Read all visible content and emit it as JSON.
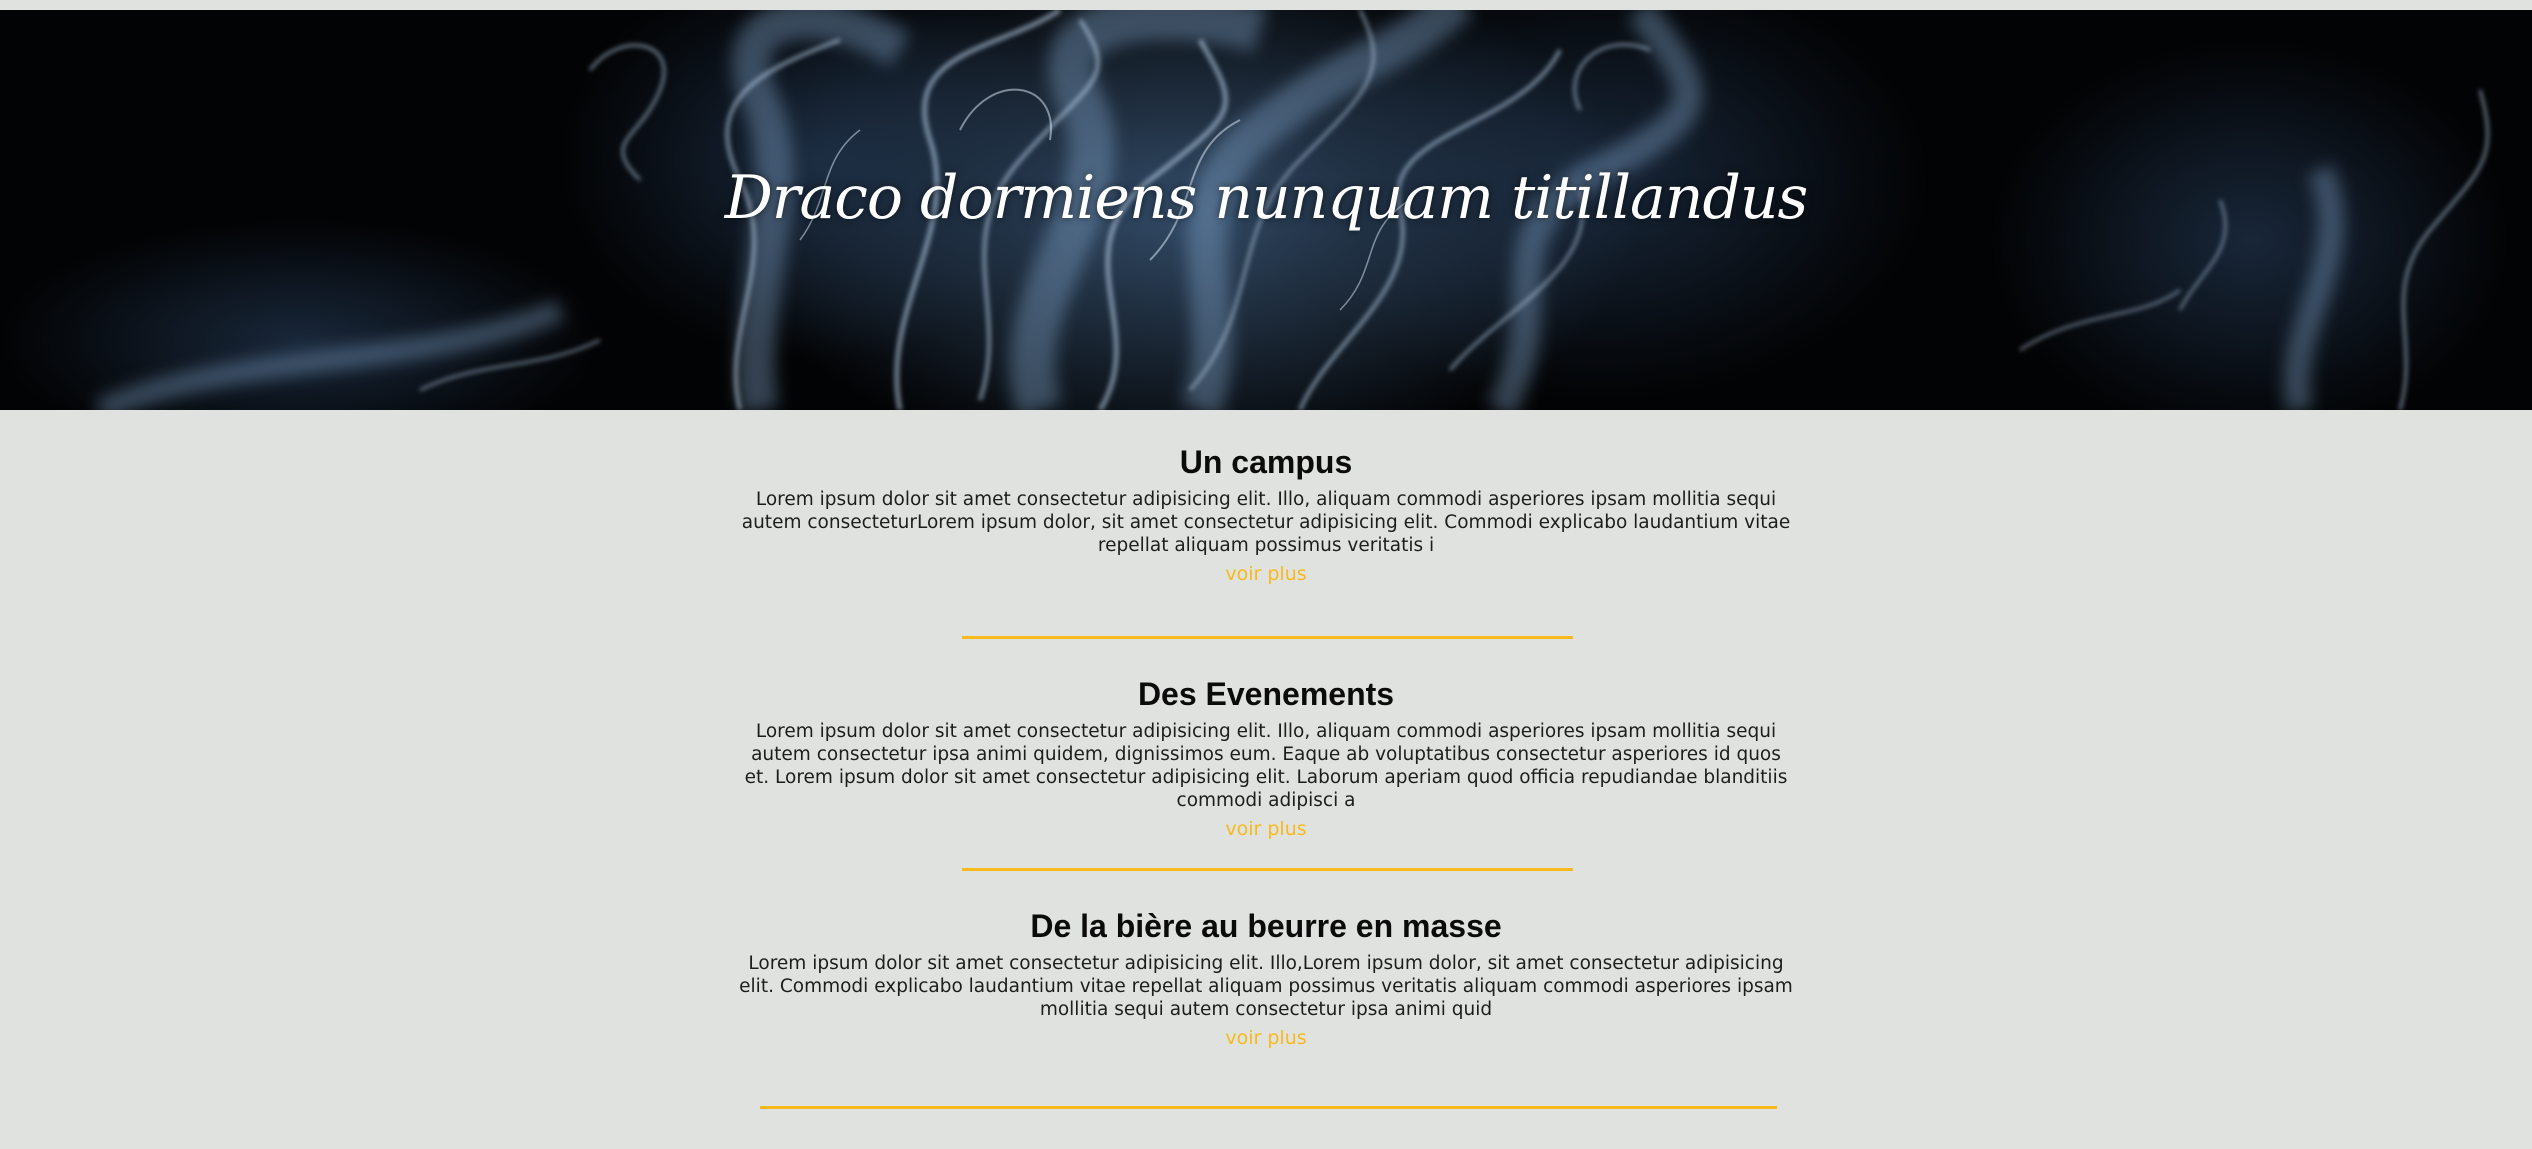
{
  "hero": {
    "title": "Draco dormiens nunquam titillandus"
  },
  "sections": [
    {
      "heading": "Un campus",
      "text": "Lorem ipsum dolor sit amet consectetur adipisicing elit. Illo, aliquam commodi asperiores ipsam mollitia sequi autem consecteturLorem ipsum dolor, sit amet consectetur adipisicing elit. Commodi explicabo laudantium vitae repellat aliquam possimus veritatis i",
      "link": "voir plus"
    },
    {
      "heading": "Des Evenements",
      "text": "Lorem ipsum dolor sit amet consectetur adipisicing elit. Illo, aliquam commodi asperiores ipsam mollitia sequi autem consectetur ipsa animi quidem, dignissimos eum. Eaque ab voluptatibus consectetur asperiores id quos et. Lorem ipsum dolor sit amet consectetur adipisicing elit. Laborum aperiam quod officia repudiandae blanditiis commodi adipisci a",
      "link": "voir plus"
    },
    {
      "heading": "De la bière au beurre en masse",
      "text": "Lorem ipsum dolor sit amet consectetur adipisicing elit. Illo,Lorem ipsum dolor, sit amet consectetur adipisicing elit. Commodi explicabo laudantium vitae repellat aliquam possimus veritatis aliquam commodi asperiores ipsam mollitia sequi autem consectetur ipsa animi quid",
      "link": "voir plus"
    }
  ],
  "colors": {
    "background": "#e0e2df",
    "accent": "#f7b91b",
    "hero_background": "#000000",
    "smoke": "#9fc3ea"
  }
}
